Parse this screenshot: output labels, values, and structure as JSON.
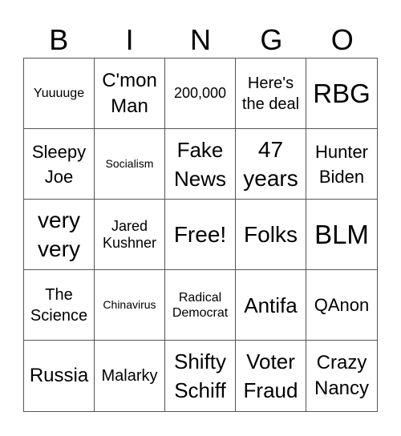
{
  "header": [
    "B",
    "I",
    "N",
    "G",
    "O"
  ],
  "cells": [
    {
      "text": "Yuuuuge",
      "size": "s16"
    },
    {
      "text": "C'mon Man",
      "size": "s24"
    },
    {
      "text": "200,000",
      "size": "s18"
    },
    {
      "text": "Here's the deal",
      "size": "s20"
    },
    {
      "text": "RBG",
      "size": "s32"
    },
    {
      "text": "Sleepy Joe",
      "size": "s22"
    },
    {
      "text": "Socialism",
      "size": "s14"
    },
    {
      "text": "Fake News",
      "size": "s26"
    },
    {
      "text": "47 years",
      "size": "s28"
    },
    {
      "text": "Hunter Biden",
      "size": "s22"
    },
    {
      "text": "very very",
      "size": "s28"
    },
    {
      "text": "Jared Kushner",
      "size": "s18"
    },
    {
      "text": "Free!",
      "size": "s28"
    },
    {
      "text": "Folks",
      "size": "s28"
    },
    {
      "text": "BLM",
      "size": "s32"
    },
    {
      "text": "The Science",
      "size": "s20"
    },
    {
      "text": "Chinavirus",
      "size": "s14"
    },
    {
      "text": "Radical Democrat",
      "size": "s16"
    },
    {
      "text": "Antifa",
      "size": "s26"
    },
    {
      "text": "QAnon",
      "size": "s22"
    },
    {
      "text": "Russia",
      "size": "s24"
    },
    {
      "text": "Malarky",
      "size": "s20"
    },
    {
      "text": "Shifty Schiff",
      "size": "s26"
    },
    {
      "text": "Voter Fraud",
      "size": "s26"
    },
    {
      "text": "Crazy Nancy",
      "size": "s24"
    }
  ]
}
